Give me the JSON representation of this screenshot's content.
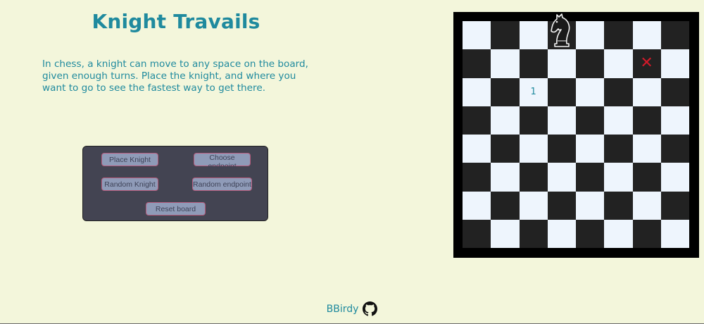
{
  "header": {
    "title": "Knight Travails"
  },
  "intro": {
    "text": "In chess, a knight can move to any space on the board, given enough turns. Place the knight, and where you want to go to see the fastest way to get there."
  },
  "controls": {
    "place_knight": "Place Knight",
    "choose_endpoint": "Choose endpoint",
    "random_knight": "Random Knight",
    "random_endpoint": "Random endpoint",
    "reset_board": "Reset board"
  },
  "board": {
    "size": 8,
    "knight_square": "d8",
    "endpoint_square": "g7",
    "path_steps": [
      {
        "square": "c6",
        "label": "1"
      }
    ],
    "colors": {
      "light": "#eef5fd",
      "dark": "#222222",
      "frame": "#000000",
      "endpoint_mark": "#d11a2a",
      "step_text": "#1f8a9e"
    },
    "icons": {
      "knight": "knight-icon",
      "endpoint": "x-mark-icon"
    }
  },
  "footer": {
    "author": "BBirdy",
    "icon": "github-icon"
  },
  "theme": {
    "background": "#f3f6db",
    "accent": "#1f8a9e",
    "panel": "#434452",
    "button": "#8f9bb8",
    "button_border": "#b45a7a"
  }
}
